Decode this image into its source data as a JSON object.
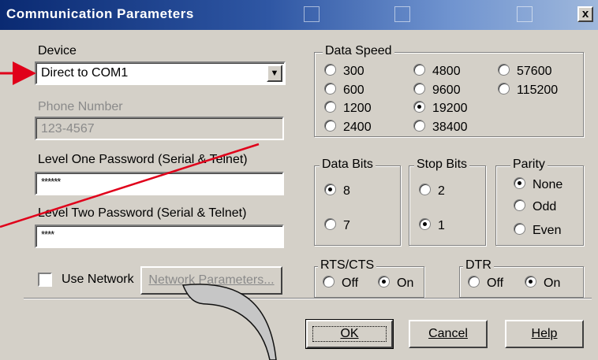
{
  "window": {
    "title": "Communication Parameters",
    "close_label": "x"
  },
  "device": {
    "label": "Device",
    "value": "Direct to COM1"
  },
  "phone": {
    "label": "Phone Number",
    "value": "123-4567"
  },
  "password1": {
    "label": "Level One Password (Serial & Telnet)",
    "value": "******"
  },
  "password2": {
    "label": "Level Two Password (Serial & Telnet)",
    "value": "****"
  },
  "network": {
    "checkbox_label": "Use Network",
    "button_label": "Network Parameters..."
  },
  "data_speed": {
    "label": "Data Speed",
    "options": [
      "300",
      "600",
      "1200",
      "2400",
      "4800",
      "9600",
      "19200",
      "38400",
      "57600",
      "115200"
    ],
    "selected": "19200"
  },
  "data_bits": {
    "label": "Data Bits",
    "options": [
      "8",
      "7"
    ],
    "selected": "8"
  },
  "stop_bits": {
    "label": "Stop Bits",
    "options": [
      "2",
      "1"
    ],
    "selected": "1"
  },
  "parity": {
    "label": "Parity",
    "options": [
      "None",
      "Odd",
      "Even"
    ],
    "selected": "None"
  },
  "rts_cts": {
    "label": "RTS/CTS",
    "options": [
      "Off",
      "On"
    ],
    "selected": "On"
  },
  "dtr": {
    "label": "DTR",
    "options": [
      "Off",
      "On"
    ],
    "selected": "On"
  },
  "buttons": {
    "ok": "OK",
    "cancel": "Cancel",
    "help": "Help"
  },
  "colors": {
    "dialog_bg": "#d4d0c8",
    "title_start": "#0a2a72",
    "title_end": "#9fb8dc",
    "annotation": "#e0001a"
  }
}
